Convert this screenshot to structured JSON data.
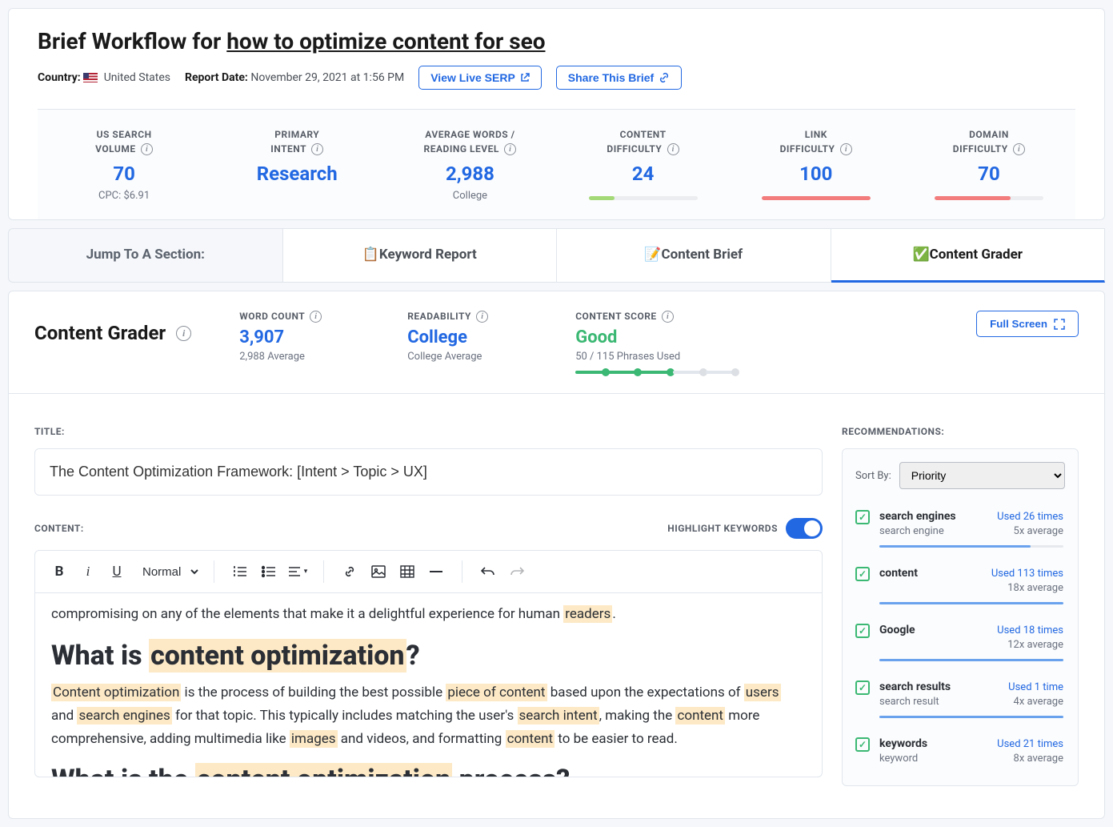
{
  "header": {
    "title_prefix": "Brief Workflow for ",
    "title_keyword": "how to optimize content for seo",
    "country_label": "Country:",
    "country_value": "United States",
    "report_date_label": "Report Date:",
    "report_date_value": "November 29, 2021 at 1:56 PM",
    "view_serp_btn": "View Live SERP",
    "share_btn": "Share This Brief"
  },
  "stats": {
    "search_volume": {
      "label_l1": "US SEARCH",
      "label_l2": "VOLUME",
      "value": "70",
      "sub": "CPC: $6.91"
    },
    "primary_intent": {
      "label_l1": "PRIMARY",
      "label_l2": "INTENT",
      "value": "Research"
    },
    "avg_words": {
      "label_l1": "AVERAGE WORDS /",
      "label_l2": "READING LEVEL",
      "value": "2,988",
      "sub": "College"
    },
    "content_diff": {
      "label_l1": "CONTENT",
      "label_l2": "DIFFICULTY",
      "value": "24",
      "color": "#a3d977",
      "pct": 24
    },
    "link_diff": {
      "label_l1": "LINK",
      "label_l2": "DIFFICULTY",
      "value": "100",
      "color": "#f37c7c",
      "pct": 100
    },
    "domain_diff": {
      "label_l1": "DOMAIN",
      "label_l2": "DIFFICULTY",
      "value": "70",
      "color": "#f37c7c",
      "pct": 70
    }
  },
  "tabs": {
    "jump": "Jump To A Section:",
    "keyword": "📋Keyword Report",
    "brief": "📝Content Brief",
    "grader": "✅Content Grader"
  },
  "grader": {
    "title": "Content Grader",
    "word_count": {
      "label": "WORD COUNT",
      "value": "3,907",
      "sub": "2,988 Average"
    },
    "readability": {
      "label": "READABILITY",
      "value": "College",
      "sub": "College Average"
    },
    "score": {
      "label": "CONTENT SCORE",
      "value": "Good",
      "sub": "50 / 115 Phrases Used"
    },
    "fullscreen": "Full Screen"
  },
  "editor": {
    "title_label": "TITLE:",
    "title_value": "The Content Optimization Framework: [Intent > Topic > UX]",
    "content_label": "CONTENT:",
    "highlight_label": "HIGHLIGHT KEYWORDS",
    "format_dropdown": "Normal"
  },
  "recommendations": {
    "label": "RECOMMENDATIONS:",
    "sort_label": "Sort By:",
    "sort_value": "Priority",
    "items": [
      {
        "kw": "search engines",
        "used": "Used 26 times",
        "alt": "search engine",
        "avg": "5x average",
        "fill": 82
      },
      {
        "kw": "content",
        "used": "Used 113 times",
        "alt": "",
        "avg": "18x average",
        "fill": 100
      },
      {
        "kw": "Google",
        "used": "Used 18 times",
        "alt": "",
        "avg": "12x average",
        "fill": 100
      },
      {
        "kw": "search results",
        "used": "Used 1 time",
        "alt": "search result",
        "avg": "4x average",
        "fill": 100
      },
      {
        "kw": "keywords",
        "used": "Used 21 times",
        "alt": "keyword",
        "avg": "8x average",
        "fill": 100
      }
    ]
  }
}
